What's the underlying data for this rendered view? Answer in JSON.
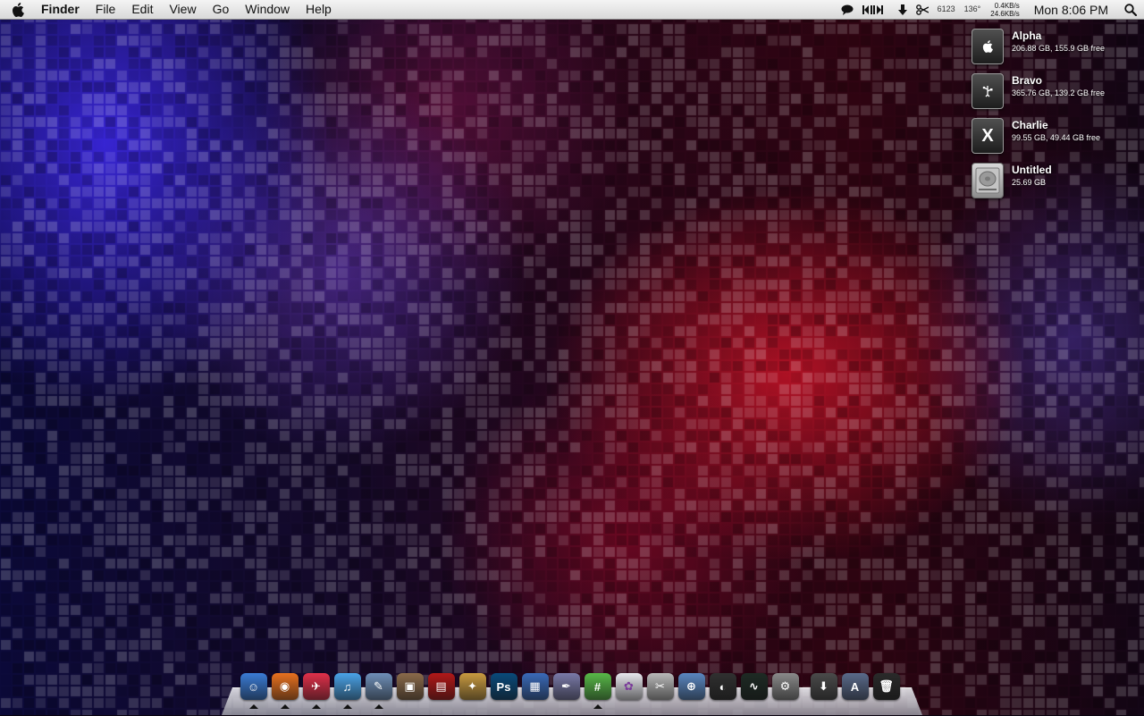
{
  "menubar": {
    "app_name": "Finder",
    "menus": [
      "File",
      "Edit",
      "View",
      "Go",
      "Window",
      "Help"
    ],
    "status": {
      "counter": "6123",
      "temperature": "136°",
      "net_up": "0.4KB/s",
      "net_down": "24.6KB/s",
      "clock": "Mon 8:06 PM"
    }
  },
  "desktop": {
    "disks": [
      {
        "name": "Alpha",
        "info": "206.88 GB, 155.9 GB free",
        "icon": "apple-disk-icon",
        "glyph": ""
      },
      {
        "name": "Bravo",
        "info": "365.76 GB, 139.2 GB free",
        "icon": "usb-disk-icon",
        "glyph": "⑂"
      },
      {
        "name": "Charlie",
        "info": "99.55 GB, 49.44 GB free",
        "icon": "x-disk-icon",
        "glyph": "X"
      },
      {
        "name": "Untitled",
        "info": "25.69 GB",
        "icon": "hard-drive-icon",
        "glyph": ""
      }
    ]
  },
  "dock": {
    "apps": [
      {
        "name": "finder",
        "glyph": "☺",
        "color": "#3a7bd5",
        "running": true
      },
      {
        "name": "firefox",
        "glyph": "◉",
        "color": "#e8711f",
        "running": true
      },
      {
        "name": "mail-pilot",
        "glyph": "✈",
        "color": "#e0304a",
        "running": true
      },
      {
        "name": "itunes",
        "glyph": "♫",
        "color": "#4aa3e8",
        "running": true
      },
      {
        "name": "preview",
        "glyph": "✎",
        "color": "#6f8fb8",
        "running": true
      },
      {
        "name": "iphoto",
        "glyph": "▣",
        "color": "#8a6a4a",
        "running": false
      },
      {
        "name": "photo-booth",
        "glyph": "▤",
        "color": "#b01818",
        "running": false
      },
      {
        "name": "aperture",
        "glyph": "✦",
        "color": "#c89a40",
        "running": false
      },
      {
        "name": "photoshop",
        "glyph": "Ps",
        "color": "#0a4a7a",
        "running": false
      },
      {
        "name": "photo-viewer",
        "glyph": "▦",
        "color": "#3a6ab8",
        "running": false
      },
      {
        "name": "script-editor",
        "glyph": "✒",
        "color": "#7a7aa8",
        "running": false
      },
      {
        "name": "adium",
        "glyph": "#",
        "color": "#58b848",
        "running": true
      },
      {
        "name": "text-editor",
        "glyph": "✿",
        "color": "#e8e8ee",
        "running": false
      },
      {
        "name": "textmate",
        "glyph": "✂",
        "color": "#b8b8b8",
        "running": false
      },
      {
        "name": "network-utility",
        "glyph": "⊕",
        "color": "#5a86c0",
        "running": false
      },
      {
        "name": "cyberduck",
        "glyph": "◐",
        "color": "#303030",
        "running": false
      },
      {
        "name": "activity-monitor",
        "glyph": "∿",
        "color": "#1e2a24",
        "running": false
      },
      {
        "name": "system-preferences",
        "glyph": "⚙",
        "color": "#8a8a8a",
        "running": false
      }
    ],
    "stacks": [
      {
        "name": "downloads-stack",
        "glyph": "⬇",
        "color": "#4a4a4a"
      },
      {
        "name": "applications-stack",
        "glyph": "A",
        "color": "#5a6a8a"
      },
      {
        "name": "trash",
        "glyph": "🗑",
        "color": "#2a2a2a"
      }
    ]
  }
}
